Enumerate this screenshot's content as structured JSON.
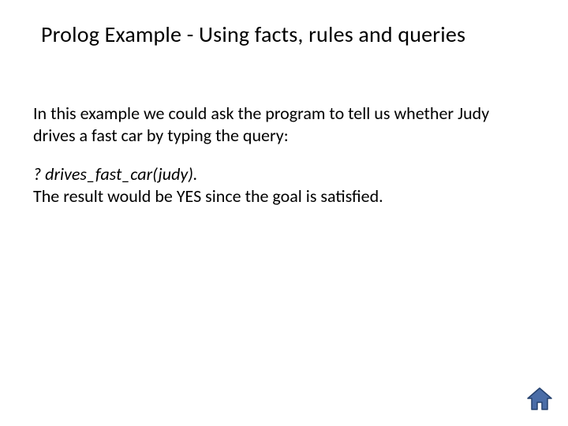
{
  "title": "Prolog Example - Using facts, rules and queries",
  "body": {
    "intro": "In this example we could ask the program to tell us whether Judy drives a fast car by typing the query:",
    "query": "? drives_fast_car(judy).",
    "result": "The result would be YES since the goal is satisfied."
  },
  "icons": {
    "home": "home-icon"
  },
  "colors": {
    "home_fill": "#4a6da7",
    "home_stroke": "#25426f"
  }
}
